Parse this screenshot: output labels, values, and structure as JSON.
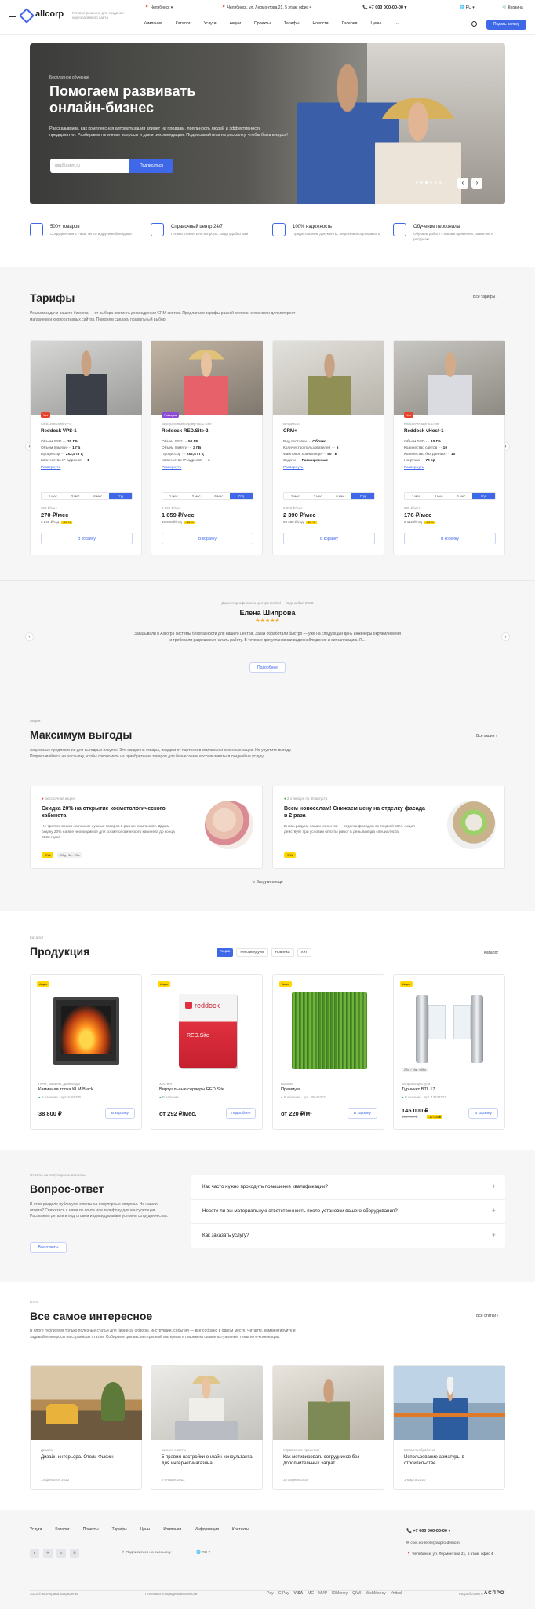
{
  "header": {
    "logo": "allcorp",
    "slogan": "Готовое решение для создания корпоративного сайта",
    "city": "Челябинск",
    "address": "Челябинск, ул. Лермонтова 21, 5 этаж, офис 4",
    "phone": "+7 000 000-00-00",
    "lang": "RU",
    "cart": "Корзина",
    "nav": [
      "Компания",
      "Каталог",
      "Услуги",
      "Акции",
      "Проекты",
      "Тарифы",
      "Новости",
      "Галерея",
      "Цены",
      "···"
    ],
    "cta": "Подать заявку"
  },
  "hero": {
    "eyebrow": "Бесплатное обучение",
    "title": "Помогаем развивать онлайн-бизнес",
    "text": "Рассказываем, как комплексная автоматизация влияет на продажи, лояльность людей и эффективность предприятия. Разбираем типичные вопросы и даем рекомендации. Подписывайтесь на рассылку, чтобы быть в курсе!",
    "placeholder": "Ваш email",
    "input_value": "qqq@aspro.ru",
    "button": "Подписаться",
    "prev": "‹",
    "next": "›"
  },
  "features": [
    {
      "title": "500+ товаров",
      "text": "Сотрудничаем с Fasa, Tenco и другими брендами",
      "icon": "box-icon"
    },
    {
      "title": "Справочный центр 24/7",
      "text": "Готовы ответить на вопросы, когда удобно вам",
      "icon": "support-icon"
    },
    {
      "title": "100% надежность",
      "text": "Предоставляем документы, лицензии и сертификаты",
      "icon": "shield-icon"
    },
    {
      "title": "Обучение персонала",
      "text": "Обучаем работе с вашим временем, развитию и ресурсам",
      "icon": "education-icon"
    }
  ],
  "tariffs": {
    "title": "Тарифы",
    "all": "Все тарифы",
    "desc": "Решаем задачи вашего бизнеса — от выбора хостинга до внедрения CRM-систем. Предлагаем тарифы разной степени сложности для интернет-магазинов и корпоративных сайтов. Поможем сделать правильный выбор.",
    "more": "Развернуть",
    "periods": [
      "1 мес",
      "3 мес",
      "6 мес",
      "Год"
    ],
    "cart_label": "В корзину",
    "items": [
      {
        "tag": "Хит",
        "tag_color": "#e8412c",
        "category": "Классический VPS",
        "name": "Reddock VPS-1",
        "specs": [
          [
            "Объем SSD",
            "20 ГБ"
          ],
          [
            "Объем памяти",
            "1 ГБ"
          ],
          [
            "Процессор",
            "2x2,4 ГГц"
          ],
          [
            "Количество IP-адресов",
            "1"
          ]
        ],
        "old": "300 ₽/мес",
        "price": "270 ₽/мес",
        "sub": "3 240 ₽/год",
        "disc": "-10 %"
      },
      {
        "tag": "Советуем",
        "tag_color": "#8e4cd6",
        "category": "Виртуальный сервер RED.Site",
        "name": "Reddock RED.Site-2",
        "specs": [
          [
            "Объем SSD",
            "50 ГБ"
          ],
          [
            "Объем памяти",
            "2 ГБ"
          ],
          [
            "Процессор",
            "2x2,4 ГГц"
          ],
          [
            "Количество IP-адресов",
            "1"
          ]
        ],
        "old": "1 890 ₽/мес",
        "price": "1 659 ₽/мес",
        "sub": "19 908 ₽/год",
        "disc": "-15 %"
      },
      {
        "tag": "",
        "tag_color": "",
        "category": "Битрикс24",
        "name": "CRM+",
        "specs": [
          [
            "Вид поставки",
            "Облако"
          ],
          [
            "Количество пользователей",
            "6"
          ],
          [
            "Файловое хранилище",
            "50 ГБ"
          ],
          [
            "Задачи",
            "Расширенные"
          ]
        ],
        "old": "2 990 ₽/мес",
        "price": "2 390 ₽/мес",
        "sub": "28 680 ₽/год",
        "disc": "-20 %"
      },
      {
        "tag": "Хит",
        "tag_color": "#e8412c",
        "category": "Классический хостинг",
        "name": "Reddock vHost-1",
        "specs": [
          [
            "Объем SSD",
            "10 ГБ"
          ],
          [
            "Количество сайтов",
            "10"
          ],
          [
            "Количество баз данных",
            "10"
          ],
          [
            "Нагрузка",
            "70 ср"
          ]
        ],
        "old": "220 ₽/мес",
        "price": "176 ₽/мес",
        "sub": "2 112 ₽/год",
        "disc": "-20 %"
      }
    ]
  },
  "review": {
    "meta": "Директор офисного центра Enthol  —  3 декабря 2020",
    "name": "Елена Шипрова",
    "stars": "★★★★★",
    "text": "Заказывали в Allcorp3 системы безопасности для нашего центра. Заказ обработали быстро — уже на следующий день инженеры окружили меня и требовали разрешения начать работу. В течение дня установили видеонаблюдение и сигнализацию. Я...",
    "button": "Подробнее"
  },
  "promos": {
    "eyebrow": "Акции",
    "title": "Максимум выгоды",
    "all": "Все акции",
    "desc": "Акционные предложения для выгодных покупок. Это скидки на товары, подарки от партнеров компании и сезонные акции. Не упустите выгоду. Подписывайтесь на рассылку, чтобы сэкономить на приобретении товаров для бизнеса или воспользоваться скидкой на услугу.",
    "load_more": "Загрузить еще",
    "items": [
      {
        "status": "Бессрочная акция",
        "status_color": "#e8412c",
        "title": "Скидка 20% на открытие косметологического кабинета",
        "text": "Не тратьте время на поиски нужных товаров в разных компаниях. Дарим скидку 20% на все необходимое для косметологического кабинета до конца 2023 года!",
        "pills": [
          "-20%",
          "201д : 5ч : 23м"
        ]
      },
      {
        "status": "2 1 января по 30 августа",
        "status_color": "#2bb44a",
        "title": "Всем новоселам! Снижаем цену на отделку фасада в 2 раза",
        "text": "Вновь радуем наших клиентов — отделка фасадов со скидкой 50%. Акция действует при условии оплаты работ в день выезда специалиста.",
        "pills": [
          "-50%"
        ]
      }
    ]
  },
  "products": {
    "eyebrow": "Каталог",
    "title": "Продукция",
    "tabs": [
      "Акции",
      "Рекомендуем",
      "Новинка",
      "Хит"
    ],
    "catalog": "Каталог",
    "items": [
      {
        "badge": "Акция",
        "category": "Печи, камины, дымоходы",
        "name": "Каминная топка KLM Black",
        "stock": "В наличии",
        "art": "Арт. 5456785",
        "price": "38 800 ₽",
        "old": "",
        "button": "В корзину"
      },
      {
        "badge": "Акция",
        "category": "Хостинг",
        "name": "Виртуальные серверы RED.Site",
        "stock": "В наличии",
        "art": "",
        "price": "от 292 ₽/мес.",
        "old": "",
        "button": "Подробнее"
      },
      {
        "badge": "Акция",
        "category": "Газоны",
        "name": "Премиум",
        "stock": "В наличии",
        "art": "Арт. 40645323",
        "price": "от 220 ₽/м²",
        "old": "",
        "button": "В корзину"
      },
      {
        "badge": "Акция",
        "category": "Вопросы доступа",
        "name": "Турникет BTL 17",
        "stock": "В наличии",
        "art": "Арт. 13433771",
        "price": "145 000 ₽",
        "old": "153 000 ₽",
        "disc": "-12 000 ₽",
        "button": "В корзину"
      }
    ],
    "mini_tags": "27кг / 16кг / 49кг",
    "reddock_brand": "reddock",
    "reddock_sub": "RED.Site"
  },
  "faq": {
    "eyebrow": "Ответы на популярные вопросы",
    "title": "Вопрос-ответ",
    "desc": "В этом разделе публикуем ответы на популярные вопросы. Не нашли ответа? Свяжитесь с нами по почте или телефону для консультации. Расскажем детали и подготовим индивидуальные условия сотрудничества.",
    "button": "Все ответы",
    "questions": [
      "Как часто нужно проходить повышение квалификации?",
      "Несете ли вы материальную ответственность после установки вашего оборудования?",
      "Как заказать услугу?"
    ]
  },
  "blog": {
    "eyebrow": "Блог",
    "title": "Все самое интересное",
    "all": "Все статьи",
    "desc": "В блоге публикуем только полезные статьи для бизнеса. Обзоры, инструкции, события — все собрано в одном месте. Читайте, комментируйте и задавайте вопросы на страницах статьи. Собираем для вас интересный материал и пишем на самые актуальные темы из е-коммерции.",
    "items": [
      {
        "category": "Дизайн",
        "title": "Дизайн интерьера. Отель Фьюжн",
        "date": "14 февраля 2022"
      },
      {
        "category": "Бизнес-советы",
        "title": "5 правил настройки онлайн-консультанта для интернет-магазина",
        "date": "9 января 2022"
      },
      {
        "category": "Управление проектом",
        "title": "Как мотивировать сотрудников без дополнительных затрат",
        "date": "28 апреля 2020"
      },
      {
        "category": "Металлообработка",
        "title": "Использование арматуры в строительстве",
        "date": "1 марта 2020"
      }
    ]
  },
  "footer": {
    "links": [
      "Услуги",
      "Каталог",
      "Проекты",
      "Тарифы",
      "Цены",
      "Компания",
      "Информация",
      "Контакты"
    ],
    "subscribe": "Подписаться на рассылку",
    "lang": "RU",
    "phone": "+7 000 000-00-00",
    "email": "chet.no-reply@aspro-demo.ru",
    "address": "Челябинск, ул. Лермонтова 21, 5 этаж, офис 4",
    "copyright": "2023 © Все права защищены",
    "privacy": "Политика конфиденциальности",
    "payments": [
      "Pay",
      "G Pay",
      "VISA",
      "MC",
      "МИР",
      "ЮMoney",
      "QIWI",
      "WebMoney",
      "Уnited"
    ],
    "dev_label": "Разработано в",
    "dev_brand": "АСПРО",
    "social": [
      "vk-icon",
      "telegram-icon",
      "ok-icon",
      "whatsapp-icon"
    ]
  }
}
